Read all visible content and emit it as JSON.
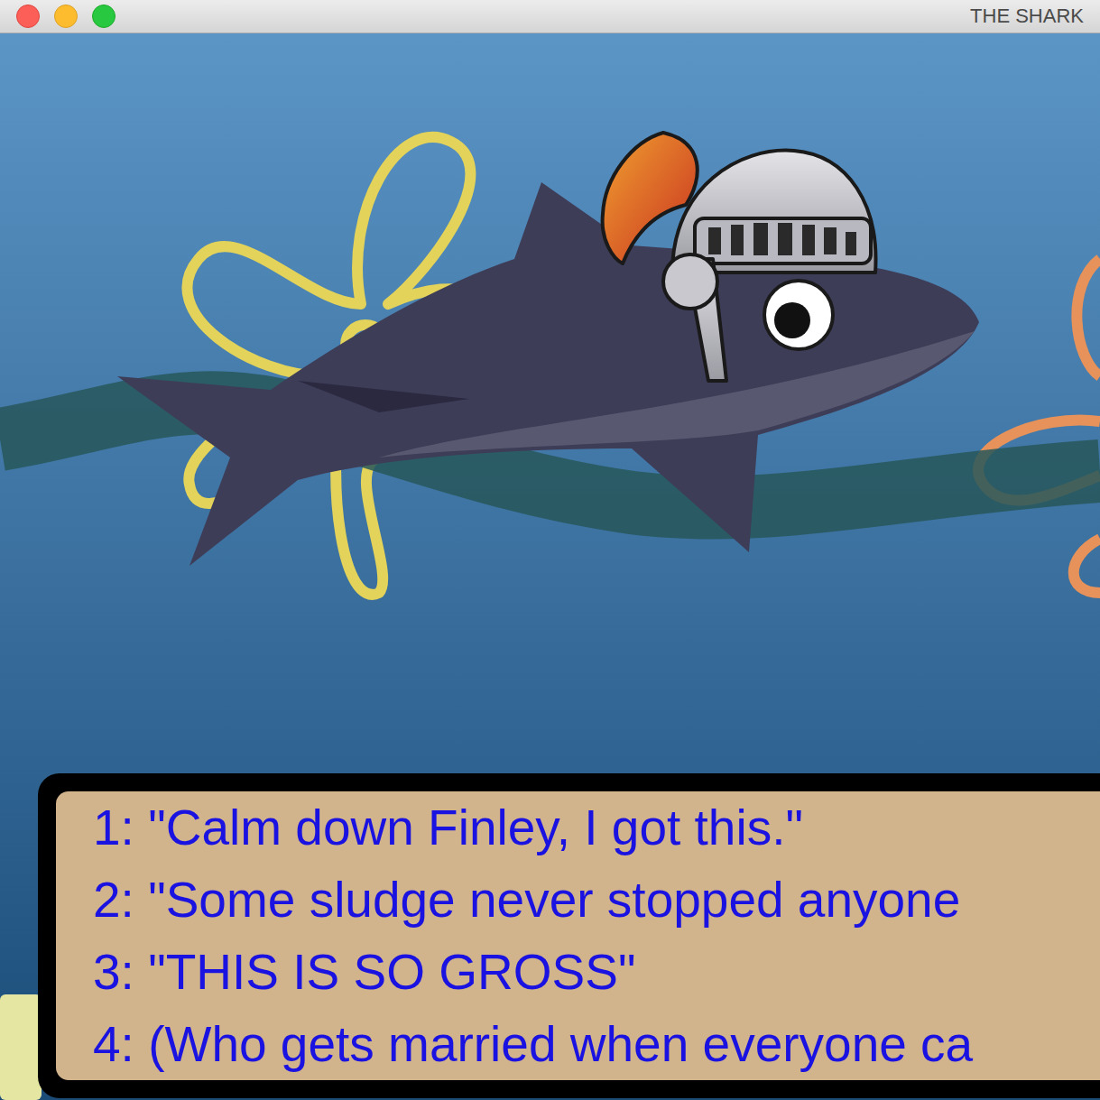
{
  "window": {
    "title": "THE SHARK"
  },
  "dialogue": {
    "options": [
      "1: \"Calm down Finley, I got this.\"",
      "2: \"Some sludge never stopped anyone",
      "3: \"THIS IS SO GROSS\"",
      "4: (Who gets married when everyone ca"
    ]
  }
}
